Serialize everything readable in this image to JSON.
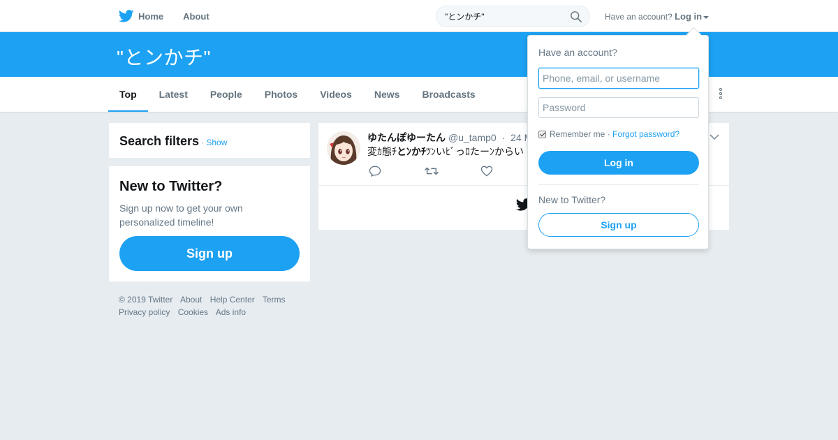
{
  "colors": {
    "brand": "#1da1f2",
    "background": "#e6ecf0",
    "text_secondary": "#657786"
  },
  "topnav": {
    "home_label": "Home",
    "about_label": "About",
    "search_value": "\"とンかチ\"",
    "account_prompt": "Have an account?",
    "login_label": "Log in"
  },
  "header": {
    "query_title": "\"とンかチ\""
  },
  "tabs": [
    {
      "label": "Top",
      "active": true
    },
    {
      "label": "Latest"
    },
    {
      "label": "People"
    },
    {
      "label": "Photos"
    },
    {
      "label": "Videos"
    },
    {
      "label": "News"
    },
    {
      "label": "Broadcasts"
    }
  ],
  "sidebar": {
    "filters_title": "Search filters",
    "filters_separator": "·",
    "filters_show": "Show",
    "new_title": "New to Twitter?",
    "new_desc": "Sign up now to get your own personalized timeline!",
    "signup_label": "Sign up"
  },
  "footer": {
    "links": [
      "© 2019 Twitter",
      "About",
      "Help Center",
      "Terms",
      "Privacy policy",
      "Cookies",
      "Ads info"
    ]
  },
  "tweet": {
    "display_name": "ゆたんぽゆーたん",
    "handle": "@u_tamp0",
    "separator": "·",
    "date": "24 M",
    "text_before": "変ｶ態ﾁ",
    "text_match": "とﾝかﾁ",
    "text_after": "ﾂﾝいﾋﾞっﾛたーﾝからい"
  },
  "login_dropdown": {
    "heading": "Have an account?",
    "username_placeholder": "Phone, email, or username",
    "password_placeholder": "Password",
    "remember_label": "Remember me",
    "separator": "·",
    "forgot_label": "Forgot password?",
    "login_button": "Log in",
    "new_prompt": "New to Twitter?",
    "signup_button": "Sign up"
  }
}
